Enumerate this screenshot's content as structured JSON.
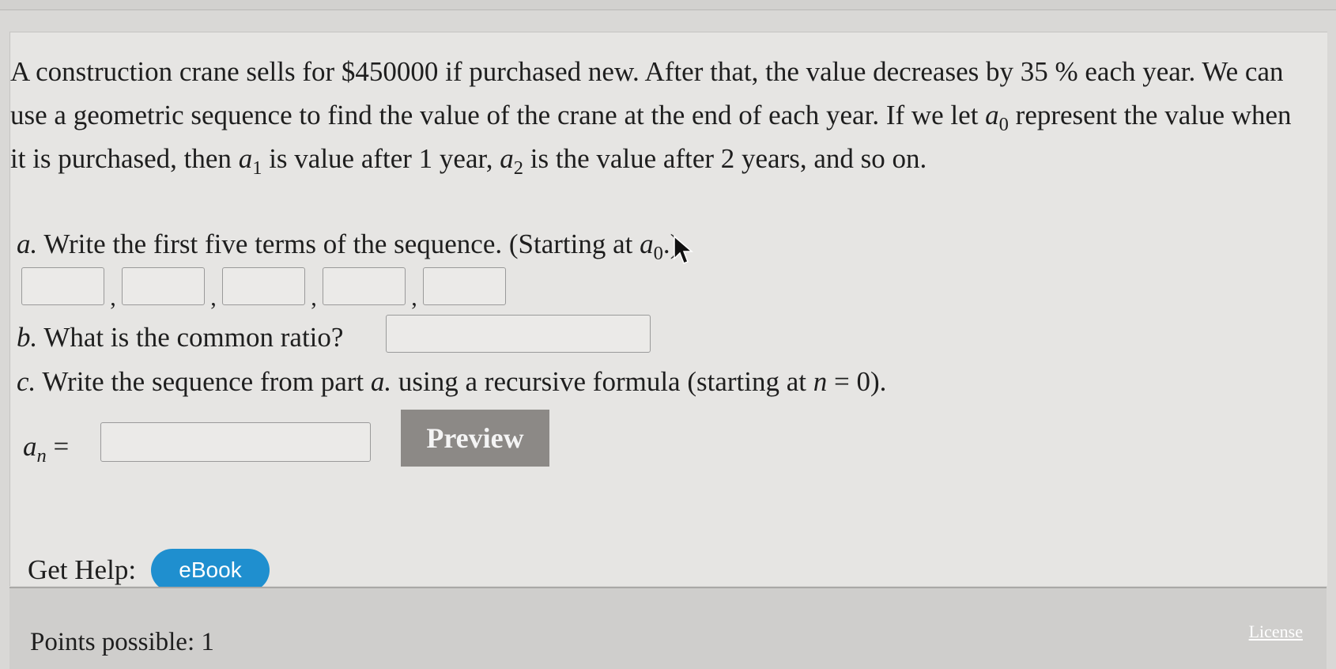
{
  "question": {
    "intro": {
      "p1": "A construction crane sells for $450000 if purchased new. After that, the value decreases by 35 %  each year. We can use a geometric sequence to find the value of the crane at the end of each year. If we let ",
      "a0": "a",
      "a0_sub": "0",
      "p2": " represent the value when it is purchased, then ",
      "a1": "a",
      "a1_sub": "1",
      "p3": " is value after 1 year, ",
      "a2": "a",
      "a2_sub": "2",
      "p4": " is the value after 2 years, and so on."
    },
    "part_a": {
      "letter": "a.",
      "text": " Write the first five terms of the sequence. (Starting at ",
      "var": "a",
      "var_sub": "0",
      "end": ".)",
      "commas": [
        ",",
        ",",
        ",",
        ","
      ]
    },
    "part_b": {
      "letter": "b.",
      "text": " What is the common ratio?"
    },
    "part_c": {
      "letter": "c.",
      "text1": " Write the sequence from part ",
      "ref": "a.",
      "text2": "  using a recursive formula (starting at ",
      "n": "n",
      "eq": " = 0)."
    },
    "formula_label": {
      "var": "a",
      "sub": "n",
      "eq": " ="
    },
    "preview_label": "Preview"
  },
  "help": {
    "label": "Get Help:",
    "ebook_label": "eBook"
  },
  "footer": {
    "points": "Points possible: 1",
    "license": "License"
  },
  "colors": {
    "preview_button": "#8c8986",
    "ebook_button": "#1f8fcf",
    "panel_bg": "#e6e5e3"
  }
}
